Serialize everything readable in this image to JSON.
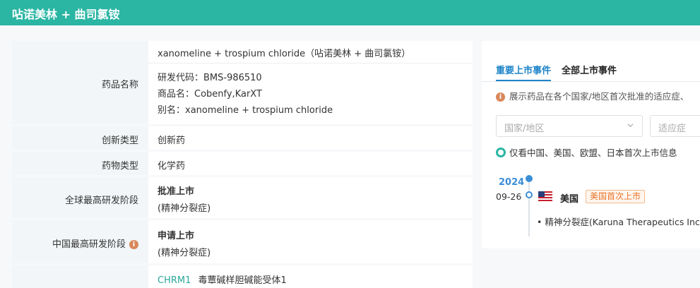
{
  "header": {
    "title": "呫诺美林 + 曲司氯铵"
  },
  "info": {
    "drug_name_label": "药品名称",
    "drug_name_full": "xanomeline + trospium chloride（呫诺美林 + 曲司氯铵）",
    "rd_code": "研发代码：BMS-986510",
    "trade_name": "商品名：Cobenfy,KarXT",
    "alias": "别名：xanomeline + trospium chloride",
    "innovation_label": "创新类型",
    "innovation_value": "创新药",
    "drug_type_label": "药物类型",
    "drug_type_value": "化学药",
    "global_stage_label": "全球最高研发阶段",
    "global_stage_value": "批准上市",
    "global_stage_indication": "(精神分裂症)",
    "china_stage_label": "中国最高研发阶段",
    "china_stage_value": "申请上市",
    "china_stage_indication": "(精神分裂症)",
    "target_code": "CHRM1",
    "target_name": "毒蕈碱样胆碱能受体1"
  },
  "launch_panel": {
    "tabs": [
      {
        "label": "重要上市事件",
        "active": true
      },
      {
        "label": "全部上市事件",
        "active": false
      }
    ],
    "hint": "展示药品在各个国家/地区首次批准的适应症、",
    "country_placeholder": "国家/地区",
    "indication_placeholder": "适应症",
    "filter_label": "仅看中国、美国、欧盟、日本首次上市信息",
    "timeline": {
      "year": "2024",
      "date": "09-26",
      "country": "美国",
      "badge": "美国首次上市",
      "indication": "• 精神分裂症(Karuna Therapeutics Inc)"
    }
  },
  "colors": {
    "header_bg": "#2bb5a3",
    "accent_blue": "#1e84c8",
    "badge_orange": "#e8742a",
    "target_teal": "#2aa79a"
  },
  "icons": {
    "info": "info-circle-icon",
    "chevron": "chevron-down-icon",
    "flag": "us-flag-icon"
  }
}
